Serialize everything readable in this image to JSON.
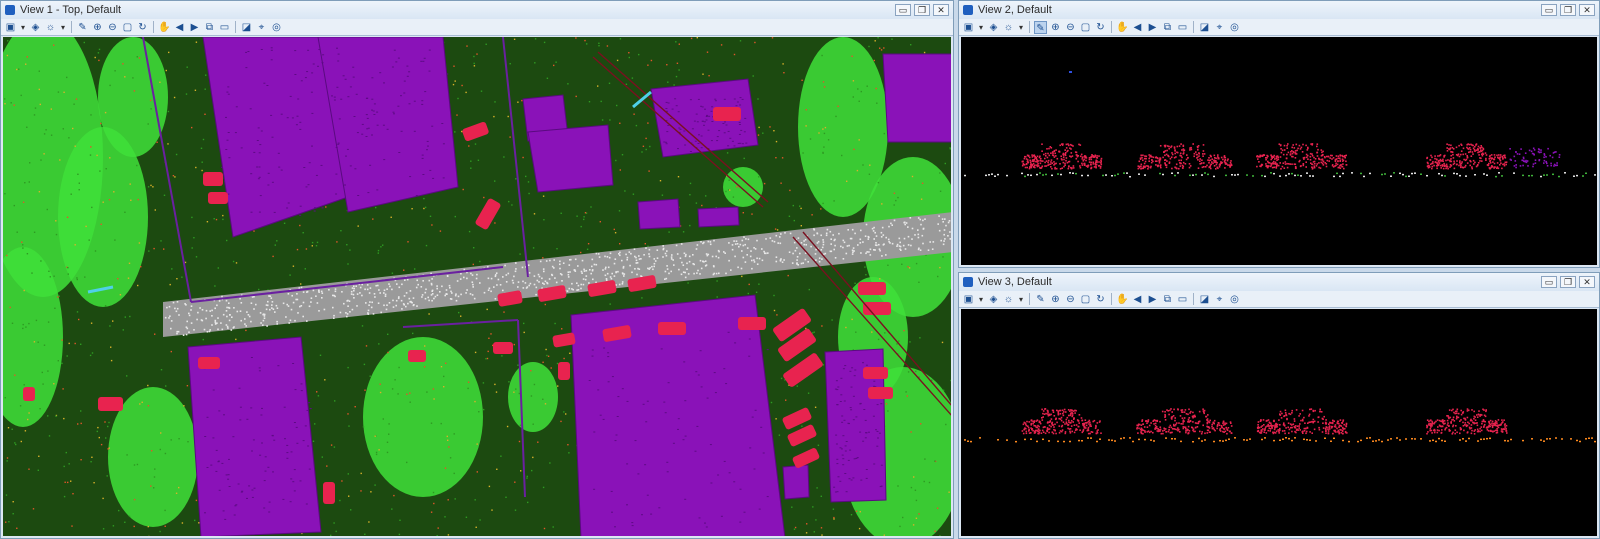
{
  "view1": {
    "title": "View 1 - Top, Default",
    "toolbar_icons": [
      "view-attributes-icon",
      "dropdown-icon",
      "display-style-icon",
      "brightness-icon",
      "dropdown-icon",
      "separator",
      "update-view-icon",
      "zoom-in-icon",
      "zoom-out-icon",
      "fit-view-icon",
      "rotate-view-icon",
      "separator",
      "pan-view-icon",
      "view-previous-icon",
      "view-next-icon",
      "copy-view-icon",
      "window-area-icon",
      "separator",
      "render-icon",
      "clip-volume-icon",
      "clip-mask-icon"
    ],
    "buttons": {
      "minimize": "▭",
      "restore": "❐",
      "close": "✕"
    }
  },
  "view2": {
    "title": "View 2, Default",
    "buttons": {
      "minimize": "▭",
      "restore": "❐",
      "close": "✕"
    }
  },
  "view3": {
    "title": "View 3, Default",
    "buttons": {
      "minimize": "▭",
      "restore": "❐",
      "close": "✕"
    }
  },
  "colors": {
    "building": "#8a12b8",
    "vegetation": "#3fe03a",
    "ground": "#1f5a12",
    "vehicle": "#e8234f",
    "road": "#e8e8e8",
    "background": "#000000",
    "ground_profile": "#ff8a1e"
  }
}
